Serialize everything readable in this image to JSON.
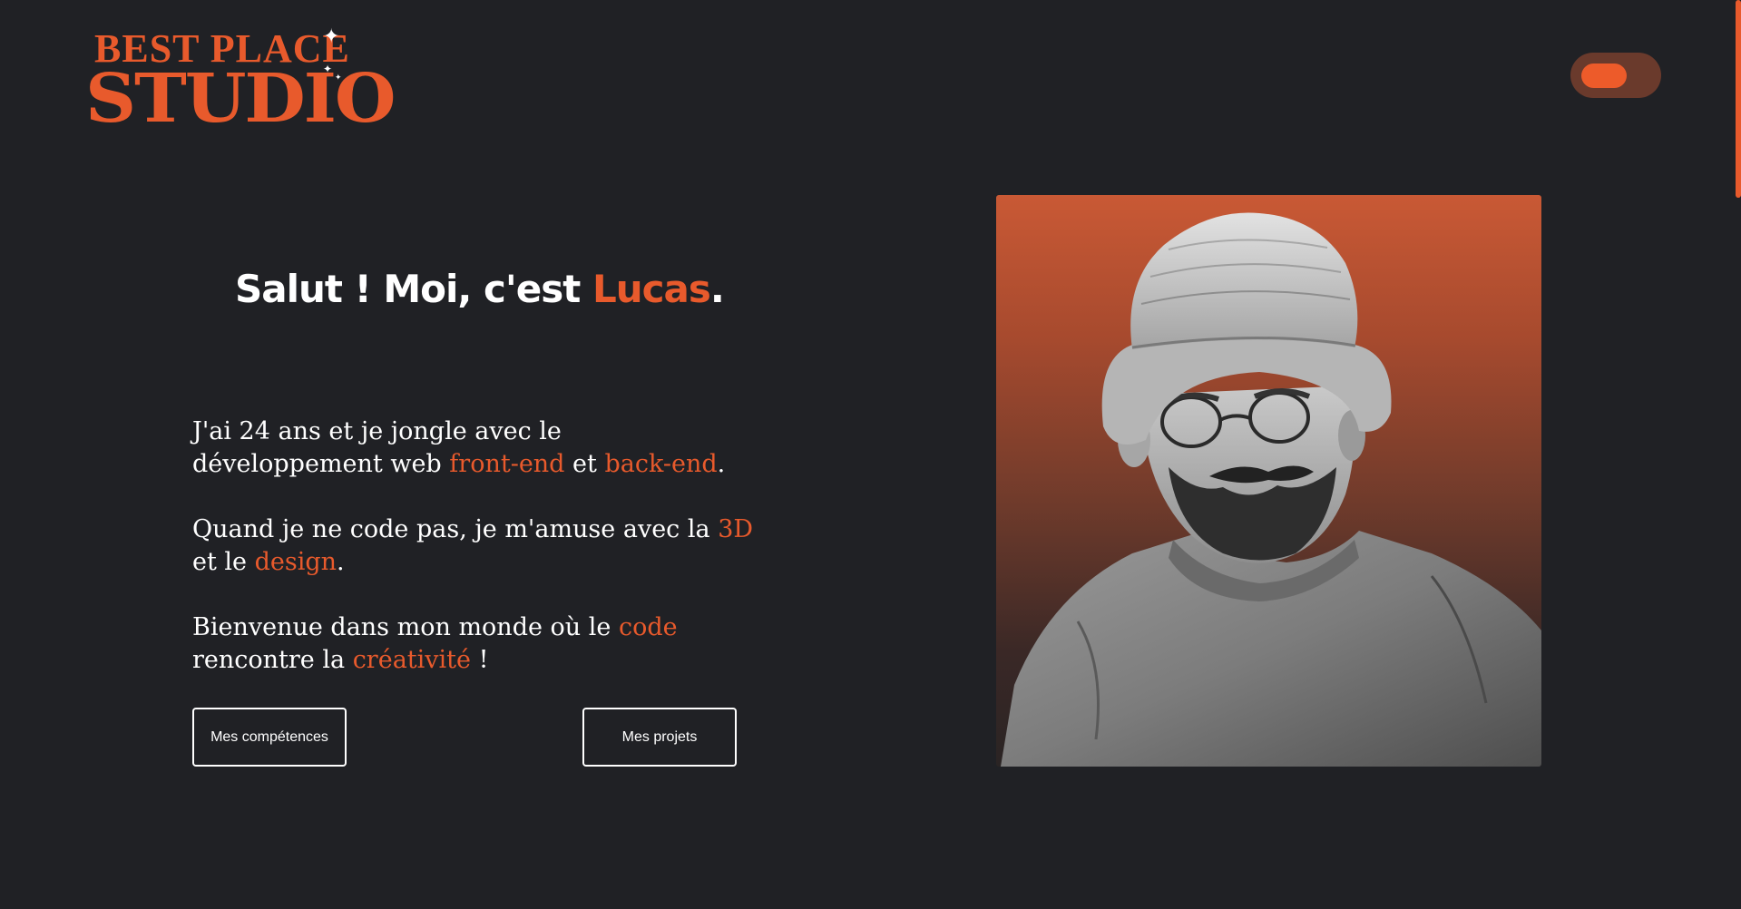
{
  "logo": {
    "line1": "BEST PLACE",
    "line2": "STUDIO"
  },
  "hero": {
    "heading": {
      "prefix": "Salut ! Moi, c'est ",
      "name": "Lucas",
      "suffix": "."
    },
    "paragraphs": {
      "p1": {
        "text1": "J'ai 24 ans et je jongle avec le développement web ",
        "accent1": "front-end",
        "text2": " et ",
        "accent2": "back-end",
        "text3": "."
      },
      "p2": {
        "text1": "Quand je ne code pas, je m'amuse avec la ",
        "accent1": "3D",
        "text2": " et le ",
        "accent2": "design",
        "text3": "."
      },
      "p3": {
        "text1": "Bienvenue dans mon monde où le ",
        "accent1": "code",
        "text2": " rencontre la ",
        "accent2": "créativité",
        "text3": " !"
      }
    },
    "buttons": {
      "skills": "Mes compétences",
      "projects": "Mes projets"
    }
  },
  "theme_toggle": {
    "state": "on"
  },
  "colors": {
    "background": "#202125",
    "accent": "#e85a2c",
    "text": "#ffffff",
    "toggle_track": "#6a3a2c"
  },
  "icons": {
    "sparkles": "sparkle-icon"
  }
}
